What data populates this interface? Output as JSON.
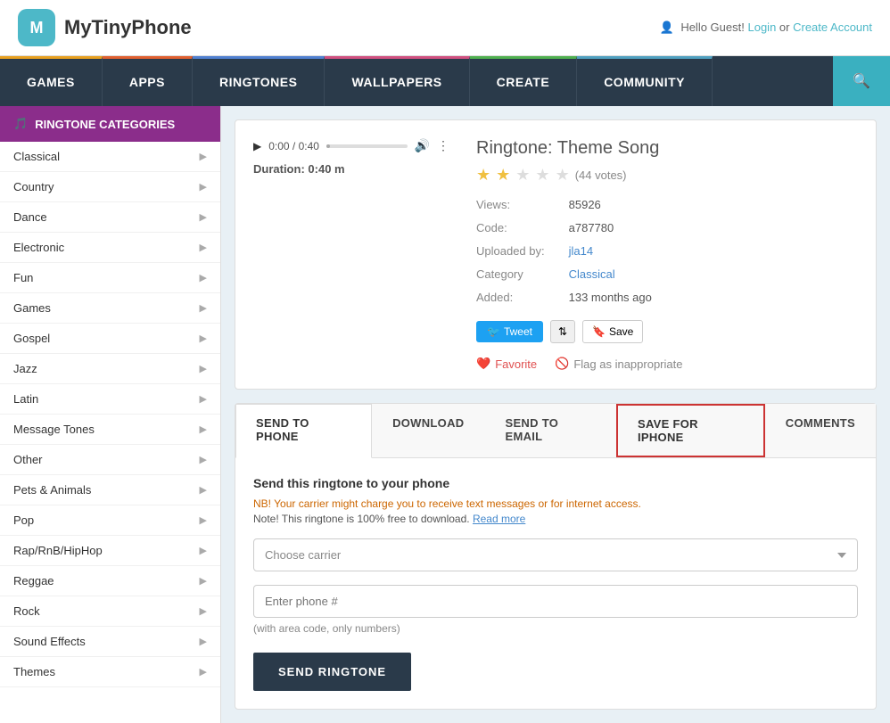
{
  "header": {
    "logo_letter": "M",
    "logo_name": "MyTinyPhone",
    "greeting": "Hello Guest!",
    "login_label": "Login",
    "or_text": "or",
    "create_account_label": "Create Account"
  },
  "nav": {
    "items": [
      {
        "id": "games",
        "label": "GAMES"
      },
      {
        "id": "apps",
        "label": "APPS"
      },
      {
        "id": "ringtones",
        "label": "RINGTONES"
      },
      {
        "id": "wallpapers",
        "label": "WALLPAPERS"
      },
      {
        "id": "create",
        "label": "CREATE"
      },
      {
        "id": "community",
        "label": "COMMUNITY"
      }
    ],
    "search_label": "search"
  },
  "sidebar": {
    "title": "RINGTONE CATEGORIES",
    "categories": [
      "Classical",
      "Country",
      "Dance",
      "Electronic",
      "Fun",
      "Games",
      "Gospel",
      "Jazz",
      "Latin",
      "Message Tones",
      "Other",
      "Pets & Animals",
      "Pop",
      "Rap/RnB/HipHop",
      "Reggae",
      "Rock",
      "Sound Effects",
      "Themes"
    ]
  },
  "ringtone": {
    "title": "Ringtone: Theme Song",
    "time_current": "0:00",
    "time_total": "0:40",
    "duration_label": "Duration:",
    "duration_value": "0:40 m",
    "rating_filled": 2,
    "rating_empty": 3,
    "votes": "(44 votes)",
    "views_label": "Views:",
    "views_value": "85926",
    "code_label": "Code:",
    "code_value": "a787780",
    "uploaded_label": "Uploaded by:",
    "uploaded_value": "jla14",
    "category_label": "Category",
    "category_value": "Classical",
    "added_label": "Added:",
    "added_value": "133 months ago",
    "tweet_label": "Tweet",
    "save_label": "Save",
    "favorite_label": "Favorite",
    "flag_label": "Flag as inappropriate"
  },
  "tabs": {
    "items": [
      {
        "id": "send-to-phone",
        "label": "SEND TO PHONE",
        "active": true,
        "highlighted": false
      },
      {
        "id": "download",
        "label": "DOWNLOAD",
        "active": false,
        "highlighted": false
      },
      {
        "id": "send-to-email",
        "label": "SEND TO EMAIL",
        "active": false,
        "highlighted": false
      },
      {
        "id": "save-for-iphone",
        "label": "SAVE FOR IPHONE",
        "active": false,
        "highlighted": true
      },
      {
        "id": "comments",
        "label": "COMMENTS",
        "active": false,
        "highlighted": false
      }
    ]
  },
  "send_form": {
    "title": "Send this ringtone to your phone",
    "notice1": "NB! Your carrier might charge you to receive text messages or for internet access.",
    "notice2": "Note! This ringtone is 100% free to download.",
    "read_more_label": "Read more",
    "carrier_placeholder": "Choose carrier",
    "phone_placeholder": "Enter phone #",
    "phone_hint": "(with area code, only numbers)",
    "send_button_label": "SEND RINGTONE"
  },
  "colors": {
    "sidebar_title_bg": "#8b2d8b",
    "nav_bg": "#2a3a4a",
    "accent_blue": "#4488cc",
    "tab_highlight_border": "#cc3333"
  }
}
